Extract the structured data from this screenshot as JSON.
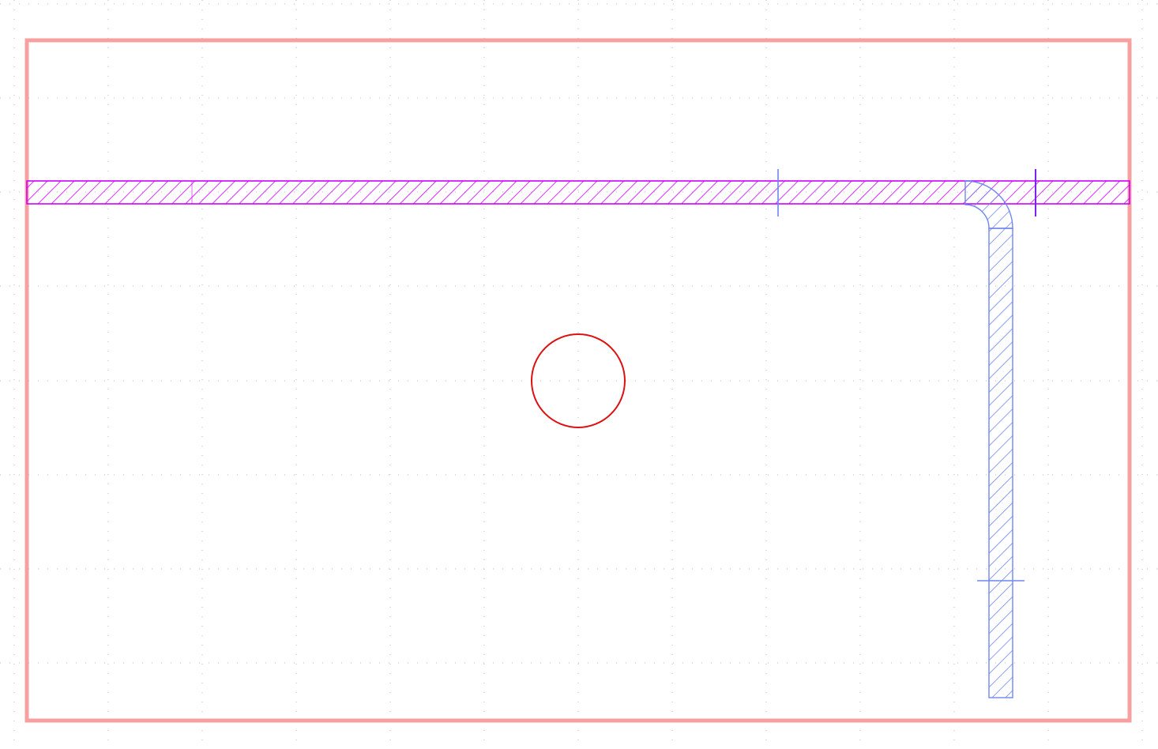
{
  "drawing": {
    "background_color": "#ffffff",
    "grid_dot_color": "#b8b8b8",
    "board_outline_color": "#f7a0a0",
    "magenta_track_color": "#cc00ff",
    "blue_track_color": "#6f86f0",
    "circle_color": "#dd1111",
    "marker_purple_color": "#7a22ee",
    "marker_blue_color": "#6f86f0"
  }
}
